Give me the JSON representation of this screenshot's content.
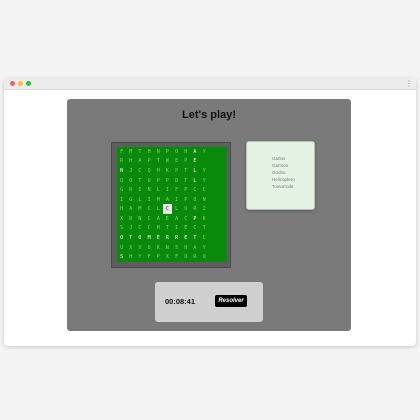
{
  "window": {
    "menu_icon": "vertical-ellipsis-icon"
  },
  "heading": "Let's play!",
  "grid": [
    [
      "F",
      "M",
      "T",
      "H",
      "N",
      "P",
      "O",
      "H",
      "A",
      "Y",
      "",
      ""
    ],
    [
      "R",
      "H",
      "A",
      "P",
      "T",
      "W",
      "E",
      "P",
      "E",
      "",
      "",
      ""
    ],
    [
      "N",
      "J",
      "C",
      "Q",
      "H",
      "K",
      "P",
      "T",
      "L",
      "Y",
      "",
      ""
    ],
    [
      "Q",
      "O",
      "T",
      "U",
      "P",
      "P",
      "D",
      "T",
      "L",
      "Y",
      "",
      ""
    ],
    [
      "G",
      "R",
      "I",
      "N",
      "L",
      "I",
      "F",
      "P",
      "C",
      "C",
      "",
      ""
    ],
    [
      "I",
      "G",
      "L",
      "I",
      "M",
      "A",
      "I",
      "P",
      "O",
      "N",
      "",
      ""
    ],
    [
      "H",
      "A",
      "M",
      "C",
      "L",
      "C",
      "L",
      "O",
      "R",
      "I",
      "",
      ""
    ],
    [
      "X",
      "R",
      "N",
      "C",
      "A",
      "E",
      "A",
      "C",
      "P",
      "K",
      "",
      ""
    ],
    [
      "S",
      "J",
      "C",
      "C",
      "H",
      "T",
      "I",
      "E",
      "C",
      "T",
      "",
      ""
    ],
    [
      "O",
      "T",
      "O",
      "M",
      "E",
      "R",
      "R",
      "E",
      "T",
      "C",
      "",
      ""
    ],
    [
      "U",
      "X",
      "V",
      "O",
      "K",
      "N",
      "S",
      "H",
      "A",
      "Y",
      "",
      ""
    ],
    [
      "S",
      "H",
      "Y",
      "F",
      "P",
      "X",
      "F",
      "O",
      "R",
      "U",
      "",
      ""
    ]
  ],
  "bright_cells": [
    [
      0,
      8
    ],
    [
      1,
      8
    ],
    [
      2,
      0
    ],
    [
      2,
      8
    ],
    [
      3,
      8
    ],
    [
      7,
      8
    ],
    [
      9,
      0
    ],
    [
      9,
      1
    ],
    [
      9,
      2
    ],
    [
      9,
      3
    ],
    [
      9,
      4
    ],
    [
      9,
      5
    ],
    [
      9,
      6
    ],
    [
      9,
      7
    ],
    [
      9,
      8
    ],
    [
      11,
      0
    ]
  ],
  "selected_cells": [
    [
      6,
      5
    ]
  ],
  "words": [
    "Garlos",
    "Garrson",
    "Gooho",
    "Helicoptero",
    "Tomorrode"
  ],
  "timer": "00:08:41",
  "solve_button": "Resolver",
  "colors": {
    "board": "#0a8a0a",
    "panel": "#7a7a7a",
    "words_bg": "#e3f2e3"
  }
}
